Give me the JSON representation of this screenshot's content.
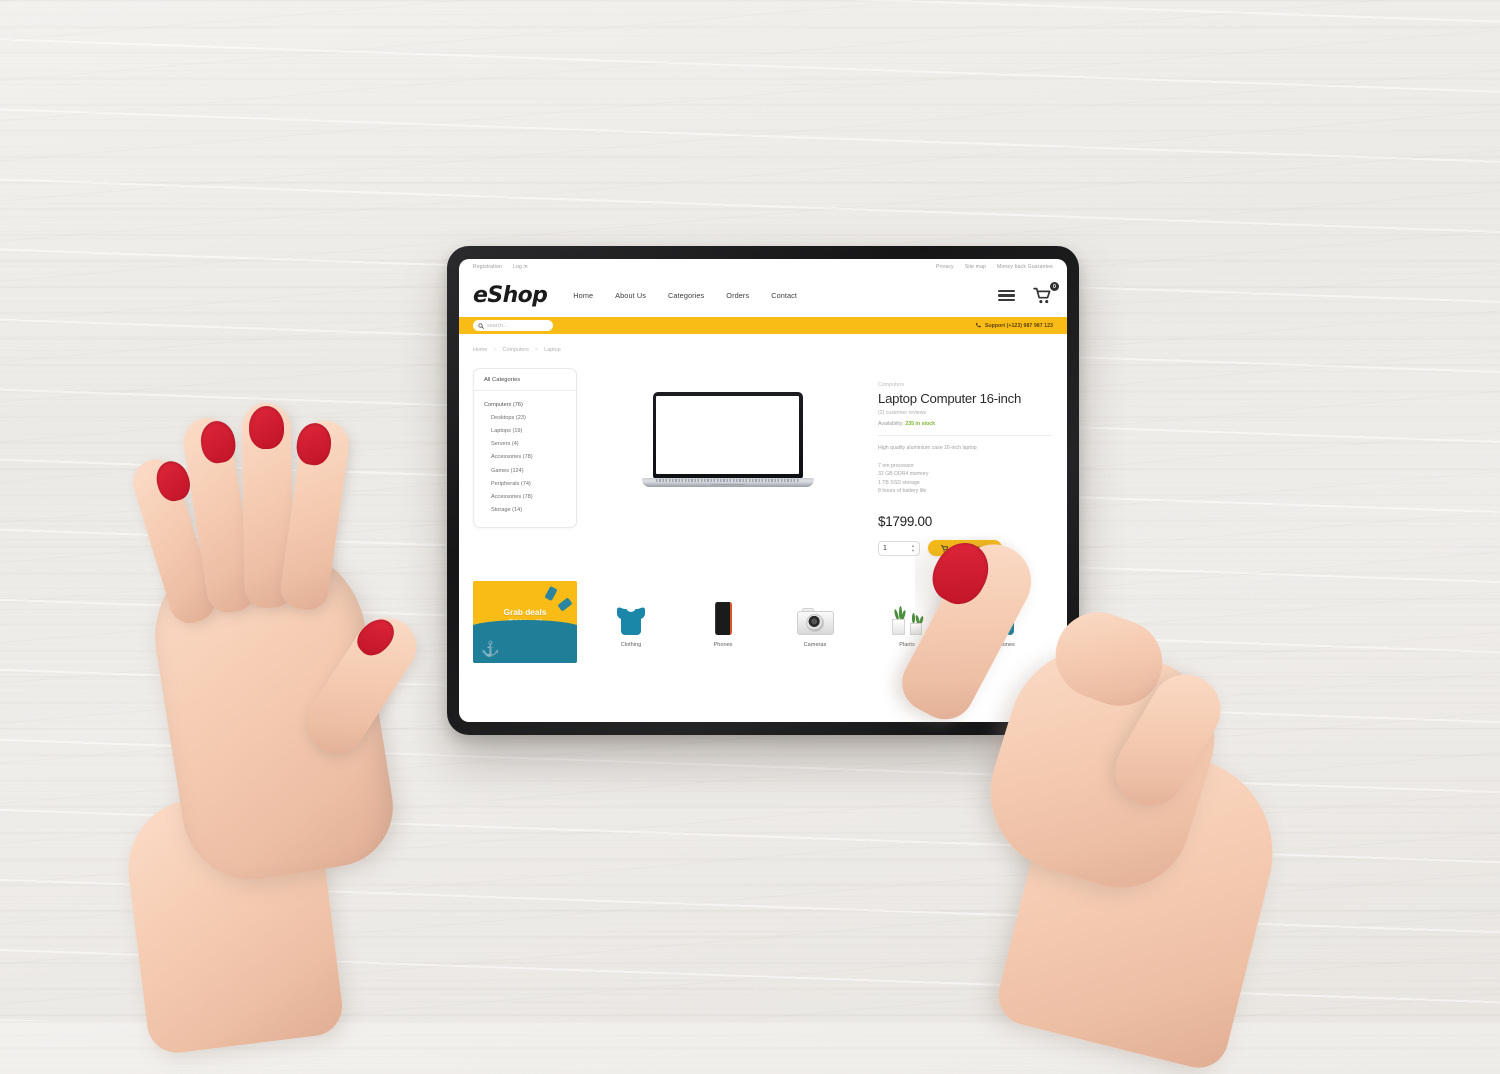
{
  "scene": {
    "description": "Tablet on white wooden desk with two hands, right index finger tapping Add to cart"
  },
  "topbar": {
    "left_links": [
      "Registration",
      "Log in"
    ],
    "right_links": [
      "Privacy",
      "Site map",
      "Money back Guarantee"
    ]
  },
  "header": {
    "logo": "eShop",
    "nav": [
      "Home",
      "About Us",
      "Categories",
      "Orders",
      "Contact"
    ],
    "menu_icon": "hamburger-icon",
    "cart_icon": "cart-icon",
    "cart_count": "0"
  },
  "searchbar": {
    "placeholder": "search...",
    "search_icon": "search-icon",
    "phone_icon": "phone-icon",
    "support": "Support (+123) 987 987 123",
    "bg_color": "#f9bc16"
  },
  "breadcrumb": [
    "Home",
    "Computers",
    "Laptop"
  ],
  "sidebar": {
    "title": "All Categories",
    "items": [
      {
        "label": "Computers (76)",
        "level": 1
      },
      {
        "label": "Desktops (23)",
        "level": 2
      },
      {
        "label": "Laptops (19)",
        "level": 2
      },
      {
        "label": "Servers (4)",
        "level": 2
      },
      {
        "label": "Accessories (78)",
        "level": 2
      },
      {
        "label": "Games (124)",
        "level": 2
      },
      {
        "label": "Peripherals (74)",
        "level": 2
      },
      {
        "label": "Accessories (78)",
        "level": 2
      },
      {
        "label": "Storage (14)",
        "level": 2
      }
    ]
  },
  "product": {
    "image_alt": "laptop-product-image",
    "category": "Computers",
    "title": "Laptop Computer 16-inch",
    "reviews": "(2) customer reviews",
    "availability_label": "Availability:",
    "availability_value": "235 in stock",
    "availability_color": "#79b530",
    "description": "High quality aluminium case 16-inch laptop",
    "specs": [
      "7 nm processor",
      "32 GB DDR4 memory",
      "1 TB SSD storage",
      "8 hours of battery life"
    ],
    "price": "$1799.00",
    "quantity": "1",
    "add_to_cart": "Add to cart",
    "add_to_cart_icon": "cart-icon"
  },
  "promo": {
    "line1": "Grab deals",
    "line2": "50% off",
    "bg_color": "#f9bc16",
    "wave_color": "#1f7f99",
    "anchor_icon": "anchor-icon"
  },
  "categories": [
    {
      "label": "Clothing",
      "icon": "tshirt-icon"
    },
    {
      "label": "Phones",
      "icon": "phone-icon"
    },
    {
      "label": "Cameras",
      "icon": "camera-icon"
    },
    {
      "label": "Plants",
      "icon": "plant-icon"
    },
    {
      "label": "Headphones",
      "icon": "headphones-icon"
    }
  ]
}
